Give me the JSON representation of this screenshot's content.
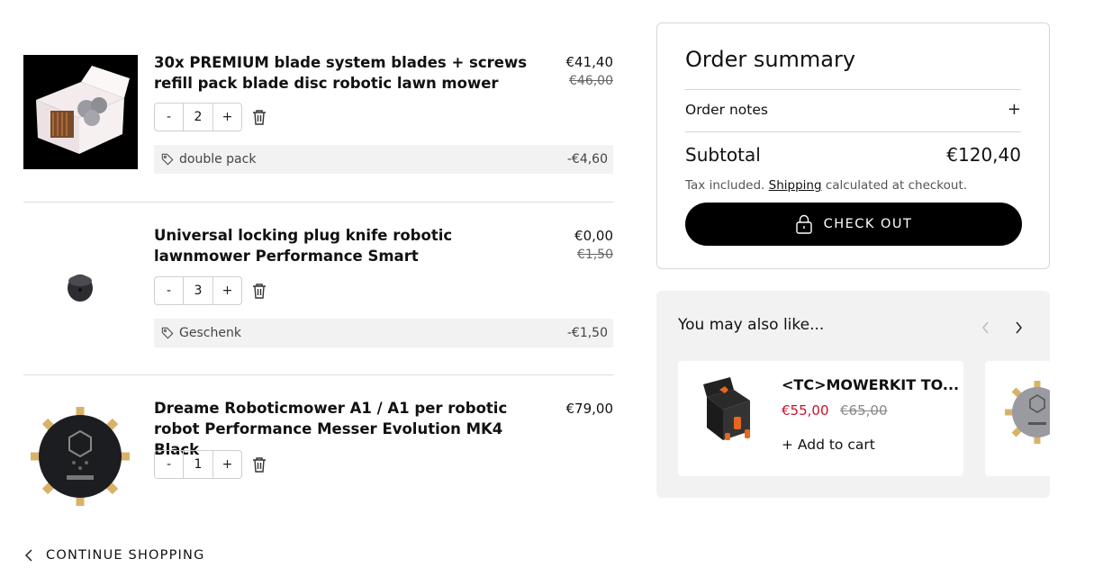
{
  "cart": {
    "items": [
      {
        "title": "30x PREMIUM blade system blades + screws refill pack blade disc robotic lawn mower",
        "price": "€41,40",
        "compare_price": "€46,00",
        "quantity": "2",
        "discount_label": "double pack",
        "discount_amount": "-€4,60"
      },
      {
        "title": "Universal locking plug knife robotic lawnmower Performance Smart",
        "price": "€0,00",
        "compare_price": "€1,50",
        "quantity": "3",
        "discount_label": "Geschenk",
        "discount_amount": "-€1,50"
      },
      {
        "title": "Dreame Roboticmower A1 / A1 per robotic robot Performance Messer Evolution MK4 Black",
        "price": "€79,00",
        "quantity": "1"
      }
    ],
    "minus_label": "-",
    "plus_label": "+",
    "continue_label": "CONTINUE SHOPPING"
  },
  "summary": {
    "title": "Order summary",
    "notes_label": "Order notes",
    "notes_toggle": "+",
    "subtotal_label": "Subtotal",
    "subtotal_value": "€120,40",
    "tax_prefix": "Tax included. ",
    "shipping_link": "Shipping",
    "tax_suffix": " calculated at checkout.",
    "checkout_label": "CHECK OUT"
  },
  "recommendations": {
    "title": "You may also like...",
    "items": [
      {
        "name": "<TC>MOWERKIT TO...",
        "sale_price": "€55,00",
        "compare_price": "€65,00",
        "add_label": "+ Add to cart"
      }
    ]
  },
  "colors": {
    "sale": "#c8102e",
    "checkout_bg": "#000000",
    "panel_bg": "#f2f2f2"
  }
}
